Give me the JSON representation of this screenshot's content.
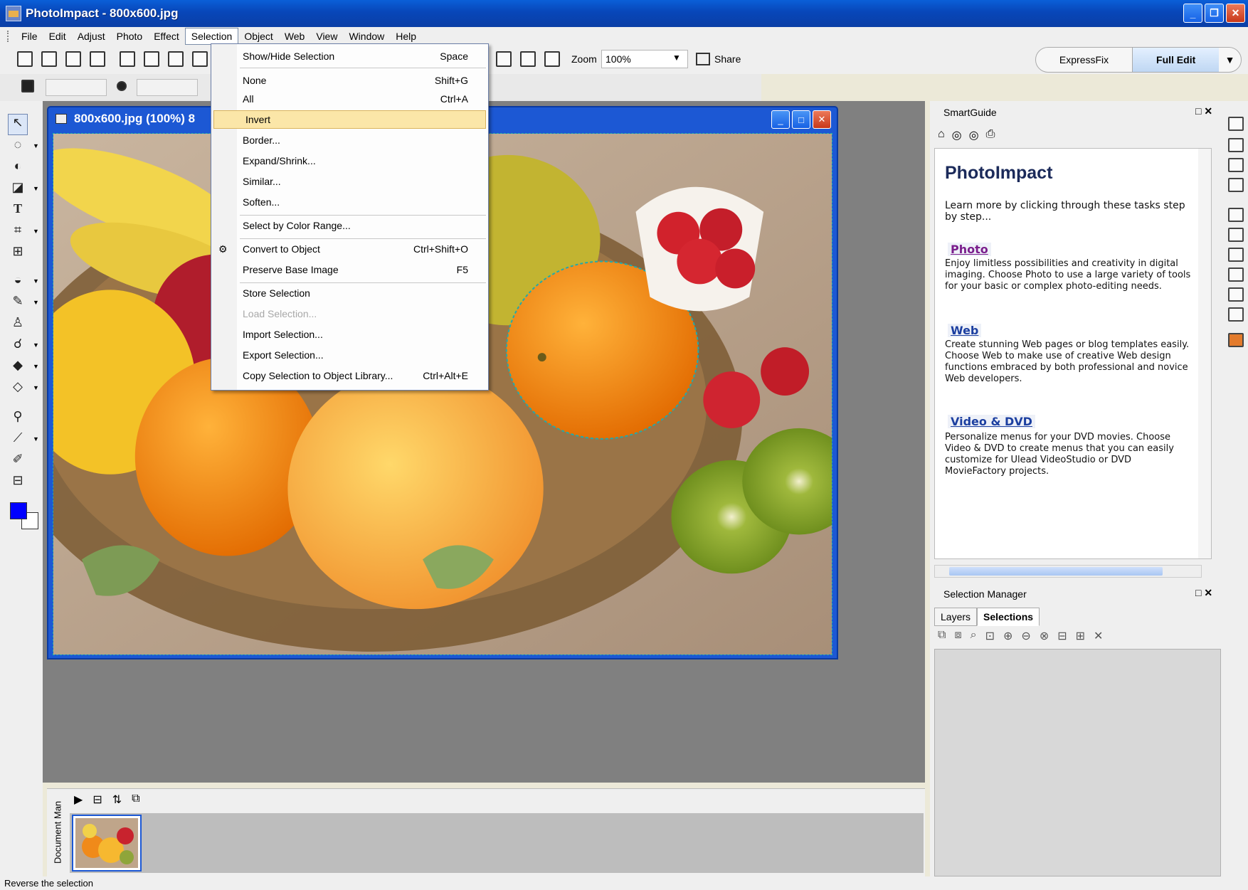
{
  "window": {
    "title": "PhotoImpact - 800x600.jpg",
    "minimize": "_",
    "restore": "❐",
    "close": "✕"
  },
  "menubar": [
    "File",
    "Edit",
    "Adjust",
    "Photo",
    "Effect",
    "Selection",
    "Object",
    "Web",
    "View",
    "Window",
    "Help"
  ],
  "toolbar": {
    "zoom_label": "Zoom",
    "zoom_value": "100%",
    "share_label": "Share",
    "mode_express": "ExpressFix",
    "mode_full": "Full Edit"
  },
  "image_window": {
    "title": "800x600.jpg (100%) 8"
  },
  "selection_menu": {
    "items": [
      {
        "label": "Show/Hide Selection",
        "shortcut": "Space"
      },
      {
        "label": "None",
        "shortcut": "Shift+G"
      },
      {
        "label": "All",
        "shortcut": "Ctrl+A"
      },
      {
        "label": "Invert",
        "shortcut": ""
      },
      {
        "label": "Border...",
        "shortcut": ""
      },
      {
        "label": "Expand/Shrink...",
        "shortcut": ""
      },
      {
        "label": "Similar...",
        "shortcut": ""
      },
      {
        "label": "Soften...",
        "shortcut": ""
      },
      {
        "label": "Select by Color Range...",
        "shortcut": ""
      },
      {
        "label": "Convert to Object",
        "shortcut": "Ctrl+Shift+O"
      },
      {
        "label": "Preserve Base Image",
        "shortcut": "F5"
      },
      {
        "label": "Store Selection",
        "shortcut": ""
      },
      {
        "label": "Load Selection...",
        "shortcut": ""
      },
      {
        "label": "Import Selection...",
        "shortcut": ""
      },
      {
        "label": "Export Selection...",
        "shortcut": ""
      },
      {
        "label": "Copy Selection to Object Library...",
        "shortcut": "Ctrl+Alt+E"
      }
    ],
    "highlighted": "Invert",
    "disabled": "Load Selection..."
  },
  "smartguide": {
    "header": "SmartGuide",
    "title": "PhotoImpact",
    "intro": "Learn more by clicking through these tasks step by step...",
    "sections": [
      {
        "link": "Photo",
        "text": "Enjoy limitless possibilities and creativity in digital imaging. Choose Photo to use a large variety of tools for your basic or complex photo-editing needs."
      },
      {
        "link": "Web",
        "text": "Create stunning Web pages or blog templates easily. Choose Web to make use of creative Web design functions embraced by both professional and novice Web developers."
      },
      {
        "link": "Video & DVD",
        "text": "Personalize menus for your DVD movies. Choose Video & DVD to create menus that you can easily customize for Ulead VideoStudio or DVD MovieFactory projects."
      }
    ]
  },
  "selection_manager": {
    "header": "Selection Manager",
    "tabs": [
      "Layers",
      "Selections"
    ],
    "active_tab": "Selections"
  },
  "document_manager": {
    "label": "Document Man"
  },
  "statusbar": {
    "text": "Reverse the selection"
  },
  "colors": {
    "foreground": "#0000ff",
    "background": "#ffffff",
    "menu_highlight": "#fbe6a8"
  }
}
